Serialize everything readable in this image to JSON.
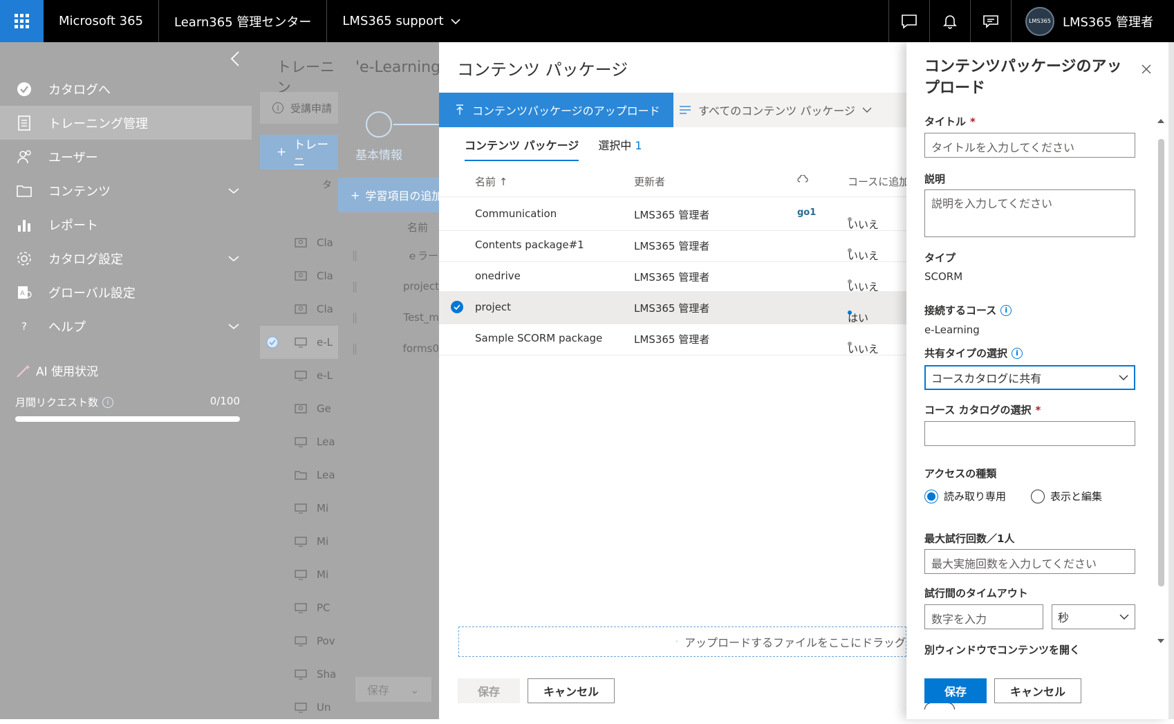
{
  "topbar": {
    "waffle_icon": "app-launcher-icon",
    "brand": "Microsoft 365",
    "admin_center": "Learn365 管理センター",
    "tenant": "LMS365 support",
    "user_name": "LMS365 管理者",
    "avatar_text": "LMS365",
    "accent": "#1f7dd6"
  },
  "sidebar": {
    "items": [
      {
        "label": "カタログへ",
        "icon": "catalog-check-icon"
      },
      {
        "label": "トレーニング管理",
        "icon": "training-icon",
        "active": true
      },
      {
        "label": "ユーザー",
        "icon": "users-icon"
      },
      {
        "label": "コンテンツ",
        "icon": "folder-icon",
        "expand": true
      },
      {
        "label": "レポート",
        "icon": "report-icon"
      },
      {
        "label": "カタログ設定",
        "icon": "settings-icon",
        "expand": true
      },
      {
        "label": "グローバル設定",
        "icon": "global-settings-icon"
      },
      {
        "label": "ヘルプ",
        "icon": "help-icon",
        "expand": true
      }
    ],
    "help_glyph": "?",
    "ai_label": "AI 使用状況",
    "monthly_requests_label": "月間リクエスト数",
    "monthly_requests_value": "0/100",
    "monthly_requests_fraction": 0.0
  },
  "training": {
    "title": "トレーニン",
    "info": "受講申請",
    "add_button": "トレーニ",
    "col": "タ",
    "rows": [
      "Cla",
      "Cla",
      "Cla",
      "e-L",
      "e-L",
      "Ge",
      "Lea",
      "Lea",
      "Mi",
      "Mi",
      "Mi",
      "PC",
      "Pov",
      "Sha",
      "Un"
    ]
  },
  "course": {
    "title": "'e-Learning",
    "step": "基本情報",
    "add_button": "学習項目の追加",
    "col_name": "名前",
    "rows": [
      "ｅラー",
      "project",
      "Test_m",
      "forms0"
    ],
    "save": "保存"
  },
  "packages": {
    "title": "コンテンツ パッケージ",
    "upload_button": "コンテンツパッケージのアップロード",
    "all_packages": "すべてのコンテンツ パッケージ",
    "tab_packages": "コンテンツ パッケージ",
    "tab_selected": "選択中",
    "selected_count": "1",
    "col_name": "名前 ↑",
    "col_updated_by": "更新者",
    "col_course_added": "コースに追加",
    "rows": [
      {
        "name": "Communication",
        "updated_by": "LMS365 管理者",
        "badge": "go1",
        "added": "いいえ"
      },
      {
        "name": "Contents package#1",
        "updated_by": "LMS365 管理者",
        "badge": "",
        "added": "いいえ"
      },
      {
        "name": "onedrive",
        "updated_by": "LMS365 管理者",
        "badge": "",
        "added": "いいえ"
      },
      {
        "name": "project",
        "updated_by": "LMS365 管理者",
        "badge": "",
        "added": "はい",
        "selected": true
      },
      {
        "name": "Sample SCORM package",
        "updated_by": "LMS365 管理者",
        "badge": "",
        "added": "いいえ"
      }
    ],
    "dropzone": "アップロードするファイルをここにドラッグ",
    "save": "保存",
    "cancel": "キャンセル"
  },
  "upload_panel": {
    "title": "コンテンツパッケージのアップロード",
    "title_label": "タイトル",
    "title_placeholder": "タイトルを入力してください",
    "desc_label": "説明",
    "desc_placeholder": "説明を入力してください",
    "type_label": "タイプ",
    "type_value": "SCORM",
    "course_label": "接続するコース",
    "course_value": "e-Learning",
    "share_label": "共有タイプの選択",
    "share_value": "コースカタログに共有",
    "catalog_label": "コース カタログの選択",
    "access_label": "アクセスの種類",
    "access_readonly": "読み取り専用",
    "access_edit": "表示と編集",
    "max_attempts_label": "最大試行回数／1人",
    "max_attempts_placeholder": "最大実施回数を入力してください",
    "timeout_label": "試行間のタイムアウト",
    "timeout_placeholder": "数字を入力",
    "timeout_unit": "秒",
    "new_window_label": "別ウィンドウでコンテンツを開く",
    "save": "保存",
    "cancel": "キャンセル",
    "required_mark": "*",
    "primary": "#0078d4"
  }
}
